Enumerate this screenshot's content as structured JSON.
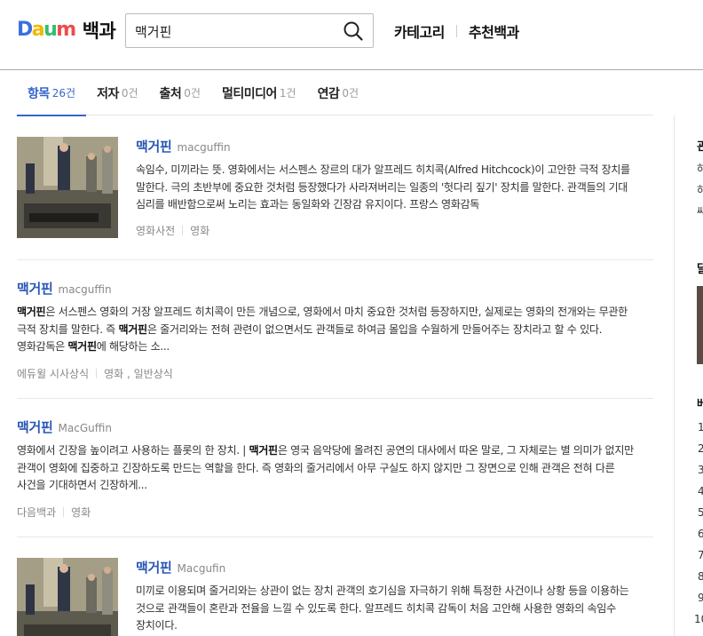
{
  "header": {
    "logo_daum": [
      "D",
      "a",
      "u",
      "m"
    ],
    "logo_service": "백과",
    "search": {
      "value": "맥거핀",
      "placeholder": ""
    },
    "nav": [
      "카테고리",
      "추천백과"
    ]
  },
  "tabs": [
    {
      "label": "항목",
      "count": "26건"
    },
    {
      "label": "저자",
      "count": "0건"
    },
    {
      "label": "출처",
      "count": "0건"
    },
    {
      "label": "멀티미디어",
      "count": "1건"
    },
    {
      "label": "연감",
      "count": "0건"
    }
  ],
  "results": [
    {
      "title": "맥거핀",
      "eng": "macguffin",
      "desc": "속임수, 미끼라는 뜻. 영화에서는 서스펜스 장르의 대가 알프레드 히치콕(Alfred Hitchcock)이 고안한 극적 장치를 말한다. 극의 초반부에 중요한 것처럼 등장했다가 사라져버리는 일종의 '헛다리 짚기' 장치를 말한다. 관객들의 기대 심리를 배반함으로써 노리는 효과는 동일화와 긴장감 유지이다. 프랑스 영화감독",
      "source": "영화사전",
      "category": "영화"
    },
    {
      "title": "맥거핀",
      "eng": "macguffin",
      "desc_parts": [
        {
          "t": "맥거핀",
          "b": true
        },
        {
          "t": "은 서스펜스 영화의 거장 알프레드 히치콕이 만든 개념으로, 영화에서 마치 중요한 것처럼 등장하지만, 실제로는 영화의 전개와는 무관한 극적 장치를 말한다. 즉 ",
          "b": false
        },
        {
          "t": "맥거핀",
          "b": true
        },
        {
          "t": "은 줄거리와는 전혀 관련이 없으면서도 관객들로 하여금 몰입을 수월하게 만들어주는 장치라고 할 수 있다. 영화감독은 ",
          "b": false
        },
        {
          "t": "맥거핀",
          "b": true
        },
        {
          "t": "에 해당하는 소...",
          "b": false
        }
      ],
      "source": "에듀윌 시사상식",
      "category": "영화 , 일반상식"
    },
    {
      "title": "맥거핀",
      "eng": "MacGuffin",
      "desc_parts": [
        {
          "t": "영화에서 긴장을 높이려고 사용하는 플롯의 한 장치. | ",
          "b": false
        },
        {
          "t": "맥거핀",
          "b": true
        },
        {
          "t": "은 영국 음악당에 올려진 공연의 대사에서 따온 말로, 그 자체로는 별 의미가 없지만 관객이 영화에 집중하고 긴장하도록 만드는 역할을 한다. 즉 영화의 줄거리에서 아무 구실도 하지 않지만 그 장면으로 인해 관객은 전혀 다른 사건을 기대하면서 긴장하게...",
          "b": false
        }
      ],
      "source": "다음백과",
      "category": "영화"
    },
    {
      "title": "맥거핀",
      "eng": "Macgufin",
      "desc": "미끼로 이용되며 줄거리와는 상관이 없는 장치 관객의 호기심을 자극하기 위해 특정한 사건이나 상황 등을 이용하는 것으로 관객들이 혼란과 전율을 느낄 수 있도록 한다. 알프레드 히치콕 감독이 처음 고안해 사용한 영화의 속임수 장치이다."
    }
  ],
  "side": {
    "clip_chars": [
      "관",
      "하",
      "하",
      "쌔",
      "달",
      "베"
    ],
    "numbers": [
      "1",
      "2",
      "3",
      "4",
      "5",
      "6",
      "7",
      "8",
      "9",
      "10"
    ]
  }
}
